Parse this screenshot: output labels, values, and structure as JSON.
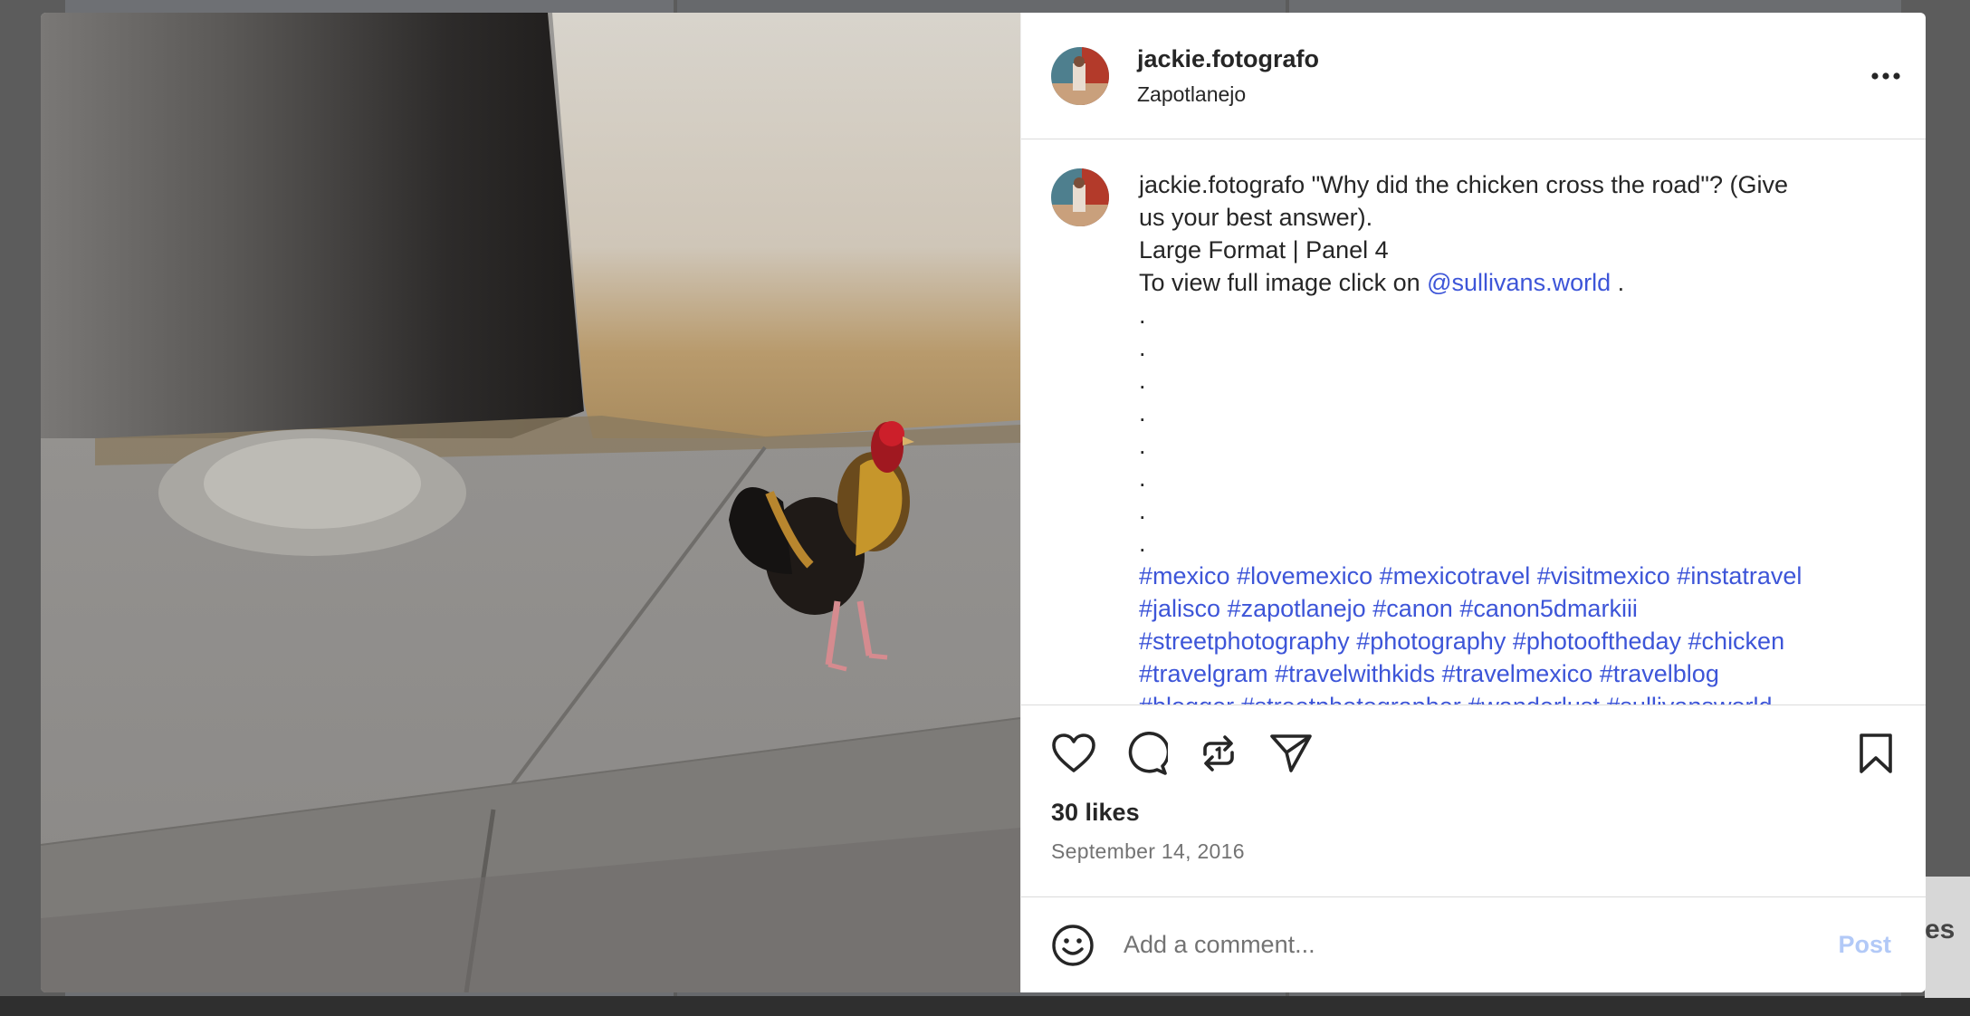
{
  "background": {
    "peek_text": "es"
  },
  "post": {
    "username": "jackie.fotografo",
    "location": "Zapotlanejo",
    "caption": {
      "username": "jackie.fotografo",
      "line1": "\"Why did the chicken cross the road\"? (Give",
      "line2": "us your best answer).",
      "line3": "Large Format | Panel 4",
      "line4_prefix": "To view full image click on ",
      "mention": "@sullivans.world",
      "line4_suffix": " .",
      "dots": [
        ".",
        ".",
        ".",
        ".",
        ".",
        ".",
        ".",
        "."
      ],
      "hashtag_lines": [
        [
          "#mexico",
          "#lovemexico",
          "#mexicotravel",
          "#visitmexico",
          "#instatravel"
        ],
        [
          "#jalisco",
          "#zapotlanejo",
          "#canon",
          "#canon5dmarkiii"
        ],
        [
          "#streetphotography",
          "#photography",
          "#photooftheday",
          "#chicken"
        ],
        [
          "#travelgram",
          "#travelwithkids",
          "#travelmexico",
          "#travelblog"
        ],
        [
          "#blogger",
          "#streetphotographer",
          "#wanderlust",
          "#sullivansworld"
        ]
      ]
    },
    "likes": "30 likes",
    "date": "September 14, 2016",
    "comment_placeholder": "Add a comment...",
    "post_label": "Post"
  },
  "icons": {
    "more": "more-horizontal-icon",
    "like": "heart-icon",
    "comment": "comment-bubble-icon",
    "repost": "repost-icon",
    "share": "send-paper-plane-icon",
    "save": "bookmark-icon",
    "emoji": "emoji-smile-icon"
  },
  "colors": {
    "link": "#3d55d8",
    "post_button_disabled": "#b2c9f7",
    "text": "#262626",
    "secondary_text": "#737373"
  }
}
